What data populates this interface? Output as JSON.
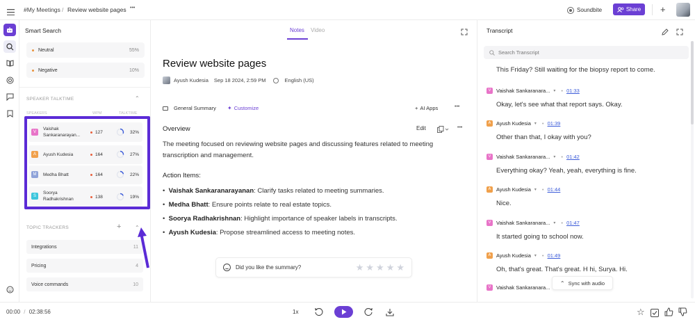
{
  "topbar": {
    "menu_icon": "hamburger-icon",
    "breadcrumb_parent": "#My Meetings",
    "breadcrumb_sep": "/",
    "breadcrumb_current": "Review website pages",
    "more": "•••",
    "soundbite_label": "Soundbite",
    "share_label": "Share",
    "add": "+"
  },
  "left": {
    "title": "Smart Search",
    "sentiments": [
      {
        "label": "Neutral",
        "value": "55%"
      },
      {
        "label": "Negative",
        "value": "10%"
      }
    ],
    "talktime": {
      "title": "SPEAKER TALKTIME",
      "col_speakers": "SPEAKERS",
      "col_wpm": "WPM",
      "col_talktime": "TALKTIME",
      "speakers": [
        {
          "initial": "V",
          "name": "Vaishak Sankaranarayan...",
          "wpm": "127",
          "talktime": "32%",
          "color": "#e874c8",
          "share": 0.32
        },
        {
          "initial": "A",
          "name": "Ayush Kudesia",
          "wpm": "164",
          "talktime": "27%",
          "color": "#f0a04b",
          "share": 0.27
        },
        {
          "initial": "M",
          "name": "Medha Bhatt",
          "wpm": "164",
          "talktime": "22%",
          "color": "#8fa3d9",
          "share": 0.22
        },
        {
          "initial": "S",
          "name": "Soorya Radhakrishnan",
          "wpm": "138",
          "talktime": "19%",
          "color": "#3cc6dd",
          "share": 0.19
        }
      ]
    },
    "trackers": {
      "title": "TOPIC TRACKERS",
      "items": [
        {
          "label": "Integrations",
          "count": "11"
        },
        {
          "label": "Pricing",
          "count": "4"
        },
        {
          "label": "Voice commands",
          "count": "10"
        }
      ]
    }
  },
  "middle": {
    "tab_notes": "Notes",
    "tab_video": "Video",
    "title": "Review website pages",
    "author": "Ayush Kudesia",
    "date": "Sep 18 2024, 2:59 PM",
    "language": "English (US)",
    "summary_type": "General Summary",
    "customize": "Customize",
    "ai_apps": "AI Apps",
    "overview_title": "Overview",
    "edit": "Edit",
    "overview_text": "The meeting focused on reviewing website pages and discussing features related to meeting transcription and management.",
    "action_title": "Action Items:",
    "actions": [
      {
        "name": "Vaishak Sankaranarayanan",
        "text": ": Clarify tasks related to meeting summaries."
      },
      {
        "name": "Medha Bhatt",
        "text": ": Ensure points relate to real estate topics."
      },
      {
        "name": "Soorya Radhakrishnan",
        "text": ": Highlight importance of speaker labels in transcripts."
      },
      {
        "name": "Ayush Kudesia",
        "text": ": Propose streamlined access to meeting notes."
      }
    ],
    "feedback_prompt": "Did you like the summary?",
    "rating": 0
  },
  "transcript": {
    "title": "Transcript",
    "search_placeholder": "Search Transcript",
    "first_line": "This Friday? Still waiting for the biopsy report to come.",
    "entries": [
      {
        "initial": "V",
        "speaker": "Vaishak Sankaranara...",
        "time": "01:33",
        "text": "Okay, let's see what that report says. Okay.",
        "color": "#e874c8"
      },
      {
        "initial": "A",
        "speaker": "Ayush Kudesia",
        "time": "01:39",
        "text": "Other than that, I okay with you?",
        "color": "#f0a04b"
      },
      {
        "initial": "V",
        "speaker": "Vaishak Sankaranara...",
        "time": "01:42",
        "text": "Everything okay? Yeah, yeah, everything is fine.",
        "color": "#e874c8"
      },
      {
        "initial": "A",
        "speaker": "Ayush Kudesia",
        "time": "01:44",
        "text": "Nice.",
        "color": "#f0a04b"
      },
      {
        "initial": "V",
        "speaker": "Vaishak Sankaranara...",
        "time": "01:47",
        "text": "It started going to school now.",
        "color": "#e874c8"
      },
      {
        "initial": "A",
        "speaker": "Ayush Kudesia",
        "time": "01:49",
        "text": "Oh, that's great. That's great. H hi, Surya. Hi.",
        "color": "#f0a04b"
      },
      {
        "initial": "V",
        "speaker": "Vaishak Sankaranara...",
        "time": "",
        "text": "",
        "color": "#e874c8"
      }
    ],
    "sync_label": "Sync with audio"
  },
  "player": {
    "current": "00:00",
    "sep": "/",
    "duration": "02:38:56",
    "speed": "1x"
  },
  "colors": {
    "accent": "#6b3fd4",
    "highlight_border": "#5b2bd6",
    "link": "#3b5bd9"
  }
}
